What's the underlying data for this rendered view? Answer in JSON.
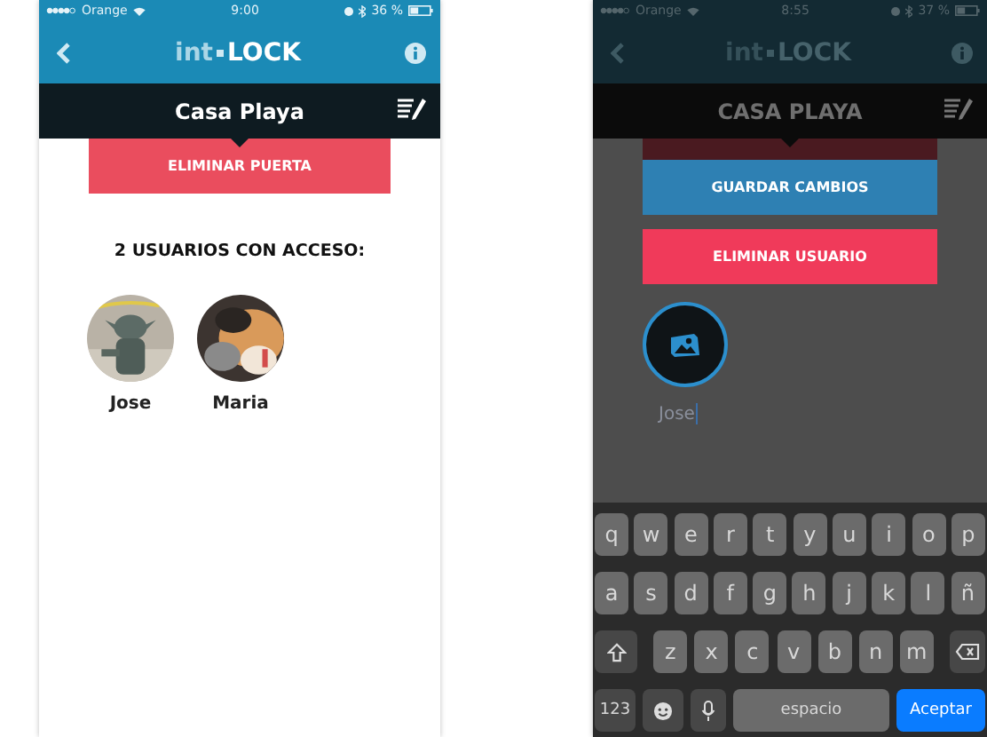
{
  "phones": [
    {
      "dimmed": false,
      "status_bar": {
        "carrier": "Orange",
        "time": "9:00",
        "battery": "36 %"
      },
      "logo": {
        "light": "int",
        "bold": "LOCK"
      },
      "header": {
        "title": "Casa Playa"
      },
      "content": {
        "kind": "door",
        "delete_button": "ELIMINAR PUERTA",
        "users_title": "2 USUARIOS CON ACCESO:",
        "users": [
          {
            "name": "Jose"
          },
          {
            "name": "Maria"
          }
        ]
      }
    },
    {
      "dimmed": true,
      "status_bar": {
        "carrier": "Orange",
        "time": "8:55",
        "battery": "37 %"
      },
      "logo": {
        "light": "int",
        "bold": "LOCK"
      },
      "header": {
        "title": "CASA PLAYA"
      },
      "content": {
        "kind": "edit_user",
        "save_button": "GUARDAR CAMBIOS",
        "delete_button": "ELIMINAR USUARIO",
        "name_field": {
          "value": "Jose",
          "focused": true
        },
        "keyboard": {
          "letter_rows": [
            [
              {
                "kind": "letter",
                "label": "q"
              },
              {
                "kind": "letter",
                "label": "w"
              },
              {
                "kind": "letter",
                "label": "e"
              },
              {
                "kind": "letter",
                "label": "r"
              },
              {
                "kind": "letter",
                "label": "t"
              },
              {
                "kind": "letter",
                "label": "y"
              },
              {
                "kind": "letter",
                "label": "u"
              },
              {
                "kind": "letter",
                "label": "i"
              },
              {
                "kind": "letter",
                "label": "o"
              },
              {
                "kind": "letter",
                "label": "p"
              }
            ],
            [
              {
                "kind": "letter",
                "label": "a"
              },
              {
                "kind": "letter",
                "label": "s"
              },
              {
                "kind": "letter",
                "label": "d"
              },
              {
                "kind": "letter",
                "label": "f"
              },
              {
                "kind": "letter",
                "label": "g"
              },
              {
                "kind": "letter",
                "label": "h"
              },
              {
                "kind": "letter",
                "label": "j"
              },
              {
                "kind": "letter",
                "label": "k"
              },
              {
                "kind": "letter",
                "label": "l"
              },
              {
                "kind": "letter",
                "label": "ñ"
              }
            ],
            [
              {
                "kind": "shift"
              },
              {
                "kind": "letter",
                "label": "z"
              },
              {
                "kind": "letter",
                "label": "x"
              },
              {
                "kind": "letter",
                "label": "c"
              },
              {
                "kind": "letter",
                "label": "v"
              },
              {
                "kind": "letter",
                "label": "b"
              },
              {
                "kind": "letter",
                "label": "n"
              },
              {
                "kind": "letter",
                "label": "m"
              },
              {
                "kind": "backspace"
              }
            ]
          ],
          "bottom_row": {
            "numbers_key": "123",
            "space_key": "espacio",
            "return_key": "Aceptar"
          }
        }
      }
    }
  ]
}
